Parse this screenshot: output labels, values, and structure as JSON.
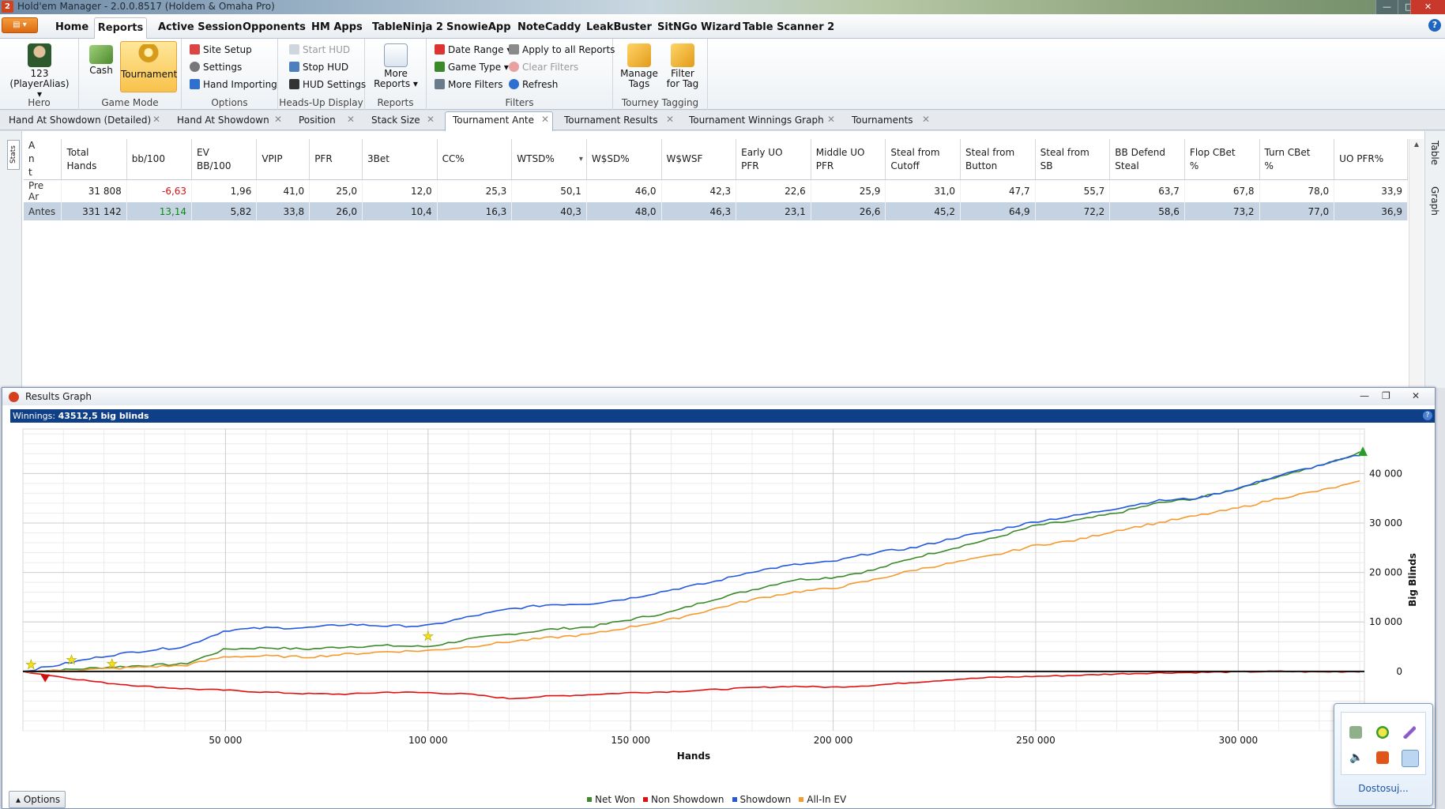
{
  "window": {
    "title": "Hold'em Manager - 2.0.0.8517 (Holdem & Omaha Pro)",
    "app_icon": "2"
  },
  "menu": {
    "app_button": "▤ ▾",
    "tabs": [
      "Home",
      "Reports",
      "Active Session",
      "Opponents",
      "HM Apps",
      "TableNinja 2",
      "SnowieApp",
      "NoteCaddy",
      "LeakBuster",
      "SitNGo Wizard",
      "Table Scanner 2"
    ],
    "help": "?"
  },
  "ribbon": {
    "hero": {
      "name": "123",
      "alias": "(PlayerAlias) ▾",
      "label": "Hero"
    },
    "game_mode": {
      "cash": "Cash",
      "tournament": "Tournament",
      "label": "Game Mode"
    },
    "options": {
      "site_setup": "Site Setup",
      "settings": "Settings",
      "hand_importing": "Hand Importing",
      "label": "Options"
    },
    "hud": {
      "start": "Start HUD",
      "stop": "Stop HUD",
      "settings": "HUD Settings",
      "label": "Heads-Up Display"
    },
    "reports": {
      "more": "More",
      "more2": "Reports ▾",
      "label": "Reports"
    },
    "filters": {
      "date_range": "Date Range ▾",
      "game_type": "Game Type ▾",
      "more_filters": "More Filters",
      "apply_all": "Apply to all Reports",
      "clear": "Clear Filters",
      "refresh": "Refresh",
      "label": "Filters"
    },
    "tagging": {
      "manage1": "Manage",
      "manage2": "Tags",
      "filter1": "Filter",
      "filter2": "for Tag",
      "label": "Tourney Tagging"
    }
  },
  "doc_tabs": [
    "Hand At Showdown (Detailed)",
    "Hand At Showdown",
    "Position",
    "Stack Size",
    "Tournament Ante",
    "Tournament Results",
    "Tournament Winnings Graph",
    "Tournaments"
  ],
  "side": {
    "stats": "Stats",
    "table": "Table",
    "graph": "Graph"
  },
  "stats_table": {
    "columns": [
      "A\nn\nt",
      "Total\nHands",
      "bb/100",
      "EV\nBB/100",
      "VPIP",
      "PFR",
      "3Bet",
      "CC%",
      "WTSD%",
      "W$SD%",
      "W$WSF",
      "Early UO\nPFR",
      "Middle UO\nPFR",
      "Steal from\nCutoff",
      "Steal from\nButton",
      "Steal from\nSB",
      "BB Defend\nSteal",
      "Flop CBet\n%",
      "Turn CBet\n%",
      "UO PFR%"
    ],
    "rows": [
      [
        "Pre Ar",
        "31 808",
        "-6,63",
        "1,96",
        "41,0",
        "25,0",
        "12,0",
        "25,3",
        "50,1",
        "46,0",
        "42,3",
        "22,6",
        "25,9",
        "31,0",
        "47,7",
        "55,7",
        "63,7",
        "67,8",
        "78,0",
        "33,9"
      ],
      [
        "Antes",
        "331 142",
        "13,14",
        "5,82",
        "33,8",
        "26,0",
        "10,4",
        "16,3",
        "40,3",
        "48,0",
        "46,3",
        "23,1",
        "26,6",
        "45,2",
        "64,9",
        "72,2",
        "58,6",
        "73,2",
        "77,0",
        "36,9"
      ]
    ]
  },
  "graph": {
    "title": "Results Graph",
    "winnings_label": "Winnings:",
    "winnings_value": "43512,5 big blinds",
    "options": "Options",
    "legend": [
      {
        "name": "Net Won",
        "color": "#3a8a2a"
      },
      {
        "name": "Non Showdown",
        "color": "#e01010"
      },
      {
        "name": "Showdown",
        "color": "#2358e0"
      },
      {
        "name": "All-In EV",
        "color": "#f59a2e"
      }
    ]
  },
  "chart_data": {
    "type": "line",
    "xlabel": "Hands",
    "ylabel": "Big Blinds",
    "xlim": [
      0,
      331142
    ],
    "ylim": [
      -12000,
      49000
    ],
    "x_ticks": [
      50000,
      100000,
      150000,
      200000,
      250000,
      300000
    ],
    "x_tick_labels": [
      "50 000",
      "100 000",
      "150 000",
      "200 000",
      "250 000",
      "300 000"
    ],
    "y_ticks": [
      0,
      10000,
      20000,
      30000,
      40000
    ],
    "y_tick_labels": [
      "0",
      "10 000",
      "20 000",
      "30 000",
      "40 000"
    ],
    "x": [
      0,
      10000,
      20000,
      30000,
      40000,
      50000,
      60000,
      70000,
      80000,
      90000,
      100000,
      110000,
      120000,
      130000,
      140000,
      150000,
      160000,
      170000,
      180000,
      190000,
      200000,
      210000,
      220000,
      230000,
      240000,
      250000,
      260000,
      270000,
      280000,
      290000,
      300000,
      310000,
      320000,
      331142
    ],
    "series": [
      {
        "name": "Net Won",
        "color": "#3a8a2a",
        "values": [
          0,
          300,
          800,
          1200,
          1500,
          4500,
          4800,
          4500,
          5000,
          5200,
          5000,
          6500,
          7500,
          8500,
          9000,
          10500,
          12000,
          14500,
          16500,
          18500,
          19000,
          20500,
          23000,
          25000,
          27000,
          29500,
          30500,
          32000,
          34000,
          35000,
          37000,
          39500,
          41500,
          44500
        ]
      },
      {
        "name": "Non Showdown",
        "color": "#e01010",
        "values": [
          0,
          -1200,
          -2300,
          -3000,
          -3500,
          -3800,
          -4200,
          -4500,
          -4600,
          -4200,
          -4300,
          -4600,
          -5500,
          -5000,
          -4700,
          -4300,
          -4100,
          -3700,
          -3300,
          -3000,
          -3200,
          -2800,
          -2200,
          -1600,
          -1200,
          -1000,
          -800,
          -500,
          -300,
          -200,
          -100,
          0,
          -100,
          0
        ]
      },
      {
        "name": "Showdown",
        "color": "#2358e0",
        "values": [
          0,
          1500,
          3100,
          4200,
          5000,
          8300,
          8800,
          8800,
          9500,
          9200,
          9200,
          11000,
          12600,
          13500,
          13700,
          14800,
          16500,
          18000,
          20200,
          21500,
          22200,
          24000,
          25000,
          27000,
          28500,
          30300,
          31500,
          33000,
          34500,
          35000,
          37000,
          39600,
          41600,
          44000
        ]
      },
      {
        "name": "All-In EV",
        "color": "#f59a2e",
        "values": [
          0,
          200,
          500,
          900,
          1200,
          3000,
          3100,
          2900,
          3500,
          4000,
          4200,
          5000,
          6000,
          6800,
          7500,
          9000,
          10500,
          12500,
          14500,
          16000,
          16800,
          18500,
          20500,
          22000,
          23500,
          25500,
          26500,
          28500,
          30000,
          31500,
          33000,
          35000,
          36500,
          38500
        ]
      }
    ]
  },
  "tray": {
    "customize": "Dostosuj..."
  }
}
